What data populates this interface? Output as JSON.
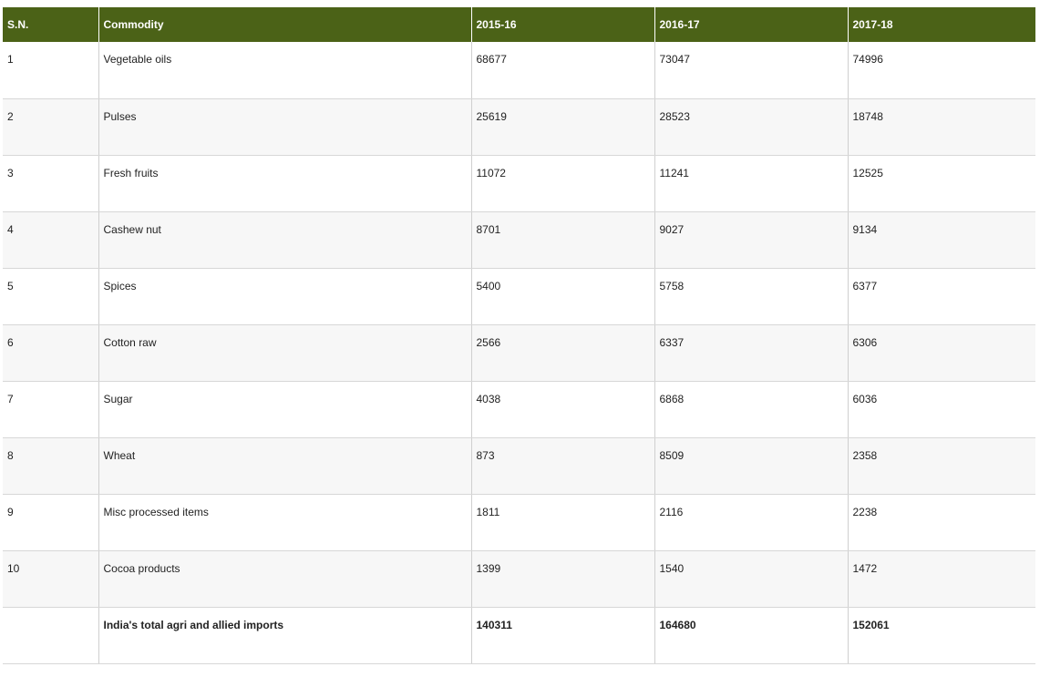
{
  "table": {
    "headers": [
      "S.N.",
      "Commodity",
      "2015-16",
      "2016-17",
      "2017-18"
    ],
    "rows": [
      [
        "1",
        "Vegetable oils",
        "68677",
        "73047",
        "74996"
      ],
      [
        "2",
        "Pulses",
        "25619",
        "28523",
        "18748"
      ],
      [
        "3",
        "Fresh fruits",
        "11072",
        "11241",
        "12525"
      ],
      [
        "4",
        "Cashew nut",
        "8701",
        "9027",
        "9134"
      ],
      [
        "5",
        "Spices",
        "5400",
        "5758",
        "6377"
      ],
      [
        "6",
        "Cotton raw",
        "2566",
        "6337",
        "6306"
      ],
      [
        "7",
        "Sugar",
        "4038",
        "6868",
        "6036"
      ],
      [
        "8",
        "Wheat",
        "873",
        "8509",
        "2358"
      ],
      [
        "9",
        "Misc processed items",
        "1811",
        "2116",
        "2238"
      ],
      [
        "10",
        "Cocoa products",
        "1399",
        "1540",
        "1472"
      ]
    ],
    "total": [
      "",
      "India's total agri and allied imports",
      "140311",
      "164680",
      "152061"
    ]
  },
  "colors": {
    "header_bg": "#4b6217",
    "header_text": "#ffffff",
    "stripe_bg": "#f7f7f7"
  }
}
